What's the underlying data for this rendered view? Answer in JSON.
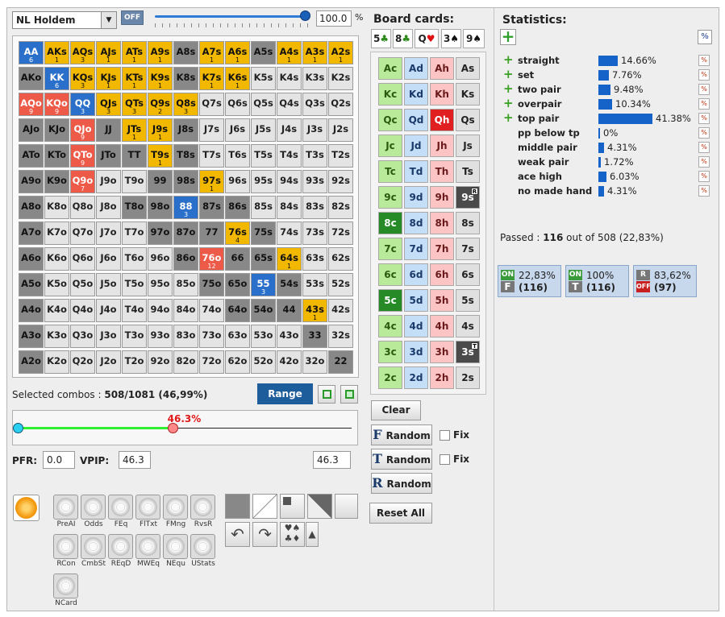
{
  "game_select": {
    "value": "NL Holdem"
  },
  "off_label": "OFF",
  "slider_value": "100.0",
  "slider_unit": "%",
  "board_title": "Board cards:",
  "board": [
    {
      "rank": "5",
      "suit": "♣",
      "color": "#2a8a1a"
    },
    {
      "rank": "8",
      "suit": "♣",
      "color": "#2a8a1a"
    },
    {
      "rank": "Q",
      "suit": "♥",
      "color": "#e01010"
    },
    {
      "rank": "3",
      "suit": "♠",
      "color": "#111111"
    },
    {
      "rank": "9",
      "suit": "♠",
      "color": "#111111"
    }
  ],
  "grid": [
    [
      [
        "AA",
        "6",
        "blue"
      ],
      [
        "AKs",
        "1",
        "yellow"
      ],
      [
        "AQs",
        "3",
        "yellow"
      ],
      [
        "AJs",
        "1",
        "yellow"
      ],
      [
        "ATs",
        "1",
        "yellow"
      ],
      [
        "A9s",
        "1",
        "yellow"
      ],
      [
        "A8s",
        "",
        "gray"
      ],
      [
        "A7s",
        "1",
        "yellow"
      ],
      [
        "A6s",
        "1",
        "yellow"
      ],
      [
        "A5s",
        "",
        "gray"
      ],
      [
        "A4s",
        "1",
        "yellow"
      ],
      [
        "A3s",
        "1",
        "yellow"
      ],
      [
        "A2s",
        "1",
        "yellow"
      ]
    ],
    [
      [
        "AKo",
        "",
        "gray"
      ],
      [
        "KK",
        "6",
        "blue"
      ],
      [
        "KQs",
        "3",
        "yellow"
      ],
      [
        "KJs",
        "1",
        "yellow"
      ],
      [
        "KTs",
        "1",
        "yellow"
      ],
      [
        "K9s",
        "1",
        "yellow"
      ],
      [
        "K8s",
        "",
        "gray"
      ],
      [
        "K7s",
        "1",
        "yellow"
      ],
      [
        "K6s",
        "1",
        "yellow"
      ],
      [
        "K5s",
        "",
        "empty"
      ],
      [
        "K4s",
        "",
        "empty"
      ],
      [
        "K3s",
        "",
        "empty"
      ],
      [
        "K2s",
        "",
        "empty"
      ]
    ],
    [
      [
        "AQo",
        "9",
        "red"
      ],
      [
        "KQo",
        "9",
        "red"
      ],
      [
        "QQ",
        "3",
        "blue"
      ],
      [
        "QJs",
        "3",
        "yellow"
      ],
      [
        "QTs",
        "3",
        "yellow"
      ],
      [
        "Q9s",
        "2",
        "yellow"
      ],
      [
        "Q8s",
        "3",
        "yellow"
      ],
      [
        "Q7s",
        "",
        "empty"
      ],
      [
        "Q6s",
        "",
        "empty"
      ],
      [
        "Q5s",
        "",
        "empty"
      ],
      [
        "Q4s",
        "",
        "empty"
      ],
      [
        "Q3s",
        "",
        "empty"
      ],
      [
        "Q2s",
        "",
        "empty"
      ]
    ],
    [
      [
        "AJo",
        "",
        "gray"
      ],
      [
        "KJo",
        "",
        "gray"
      ],
      [
        "QJo",
        "9",
        "red"
      ],
      [
        "JJ",
        "",
        "gray"
      ],
      [
        "JTs",
        "1",
        "yellow"
      ],
      [
        "J9s",
        "1",
        "yellow"
      ],
      [
        "J8s",
        "",
        "gray"
      ],
      [
        "J7s",
        "",
        "empty"
      ],
      [
        "J6s",
        "",
        "empty"
      ],
      [
        "J5s",
        "",
        "empty"
      ],
      [
        "J4s",
        "",
        "empty"
      ],
      [
        "J3s",
        "",
        "empty"
      ],
      [
        "J2s",
        "",
        "empty"
      ]
    ],
    [
      [
        "ATo",
        "",
        "gray"
      ],
      [
        "KTo",
        "",
        "gray"
      ],
      [
        "QTo",
        "9",
        "red"
      ],
      [
        "JTo",
        "",
        "gray"
      ],
      [
        "TT",
        "",
        "gray"
      ],
      [
        "T9s",
        "1",
        "yellow"
      ],
      [
        "T8s",
        "",
        "gray"
      ],
      [
        "T7s",
        "",
        "empty"
      ],
      [
        "T6s",
        "",
        "empty"
      ],
      [
        "T5s",
        "",
        "empty"
      ],
      [
        "T4s",
        "",
        "empty"
      ],
      [
        "T3s",
        "",
        "empty"
      ],
      [
        "T2s",
        "",
        "empty"
      ]
    ],
    [
      [
        "A9o",
        "",
        "gray"
      ],
      [
        "K9o",
        "",
        "gray"
      ],
      [
        "Q9o",
        "7",
        "red"
      ],
      [
        "J9o",
        "",
        "empty"
      ],
      [
        "T9o",
        "",
        "empty"
      ],
      [
        "99",
        "",
        "gray"
      ],
      [
        "98s",
        "",
        "gray"
      ],
      [
        "97s",
        "1",
        "yellow"
      ],
      [
        "96s",
        "",
        "empty"
      ],
      [
        "95s",
        "",
        "empty"
      ],
      [
        "94s",
        "",
        "empty"
      ],
      [
        "93s",
        "",
        "empty"
      ],
      [
        "92s",
        "",
        "empty"
      ]
    ],
    [
      [
        "A8o",
        "",
        "gray"
      ],
      [
        "K8o",
        "",
        "empty"
      ],
      [
        "Q8o",
        "",
        "empty"
      ],
      [
        "J8o",
        "",
        "empty"
      ],
      [
        "T8o",
        "",
        "gray"
      ],
      [
        "98o",
        "",
        "gray"
      ],
      [
        "88",
        "3",
        "blue"
      ],
      [
        "87s",
        "",
        "gray"
      ],
      [
        "86s",
        "",
        "gray"
      ],
      [
        "85s",
        "",
        "empty"
      ],
      [
        "84s",
        "",
        "empty"
      ],
      [
        "83s",
        "",
        "empty"
      ],
      [
        "82s",
        "",
        "empty"
      ]
    ],
    [
      [
        "A7o",
        "",
        "gray"
      ],
      [
        "K7o",
        "",
        "empty"
      ],
      [
        "Q7o",
        "",
        "empty"
      ],
      [
        "J7o",
        "",
        "empty"
      ],
      [
        "T7o",
        "",
        "empty"
      ],
      [
        "97o",
        "",
        "gray"
      ],
      [
        "87o",
        "",
        "gray"
      ],
      [
        "77",
        "",
        "gray"
      ],
      [
        "76s",
        "4",
        "yellow"
      ],
      [
        "75s",
        "",
        "gray"
      ],
      [
        "74s",
        "",
        "empty"
      ],
      [
        "73s",
        "",
        "empty"
      ],
      [
        "72s",
        "",
        "empty"
      ]
    ],
    [
      [
        "A6o",
        "",
        "gray"
      ],
      [
        "K6o",
        "",
        "empty"
      ],
      [
        "Q6o",
        "",
        "empty"
      ],
      [
        "J6o",
        "",
        "empty"
      ],
      [
        "T6o",
        "",
        "empty"
      ],
      [
        "96o",
        "",
        "empty"
      ],
      [
        "86o",
        "",
        "gray"
      ],
      [
        "76o",
        "12",
        "red"
      ],
      [
        "66",
        "",
        "gray"
      ],
      [
        "65s",
        "",
        "gray"
      ],
      [
        "64s",
        "1",
        "yellow"
      ],
      [
        "63s",
        "",
        "empty"
      ],
      [
        "62s",
        "",
        "empty"
      ]
    ],
    [
      [
        "A5o",
        "",
        "gray"
      ],
      [
        "K5o",
        "",
        "empty"
      ],
      [
        "Q5o",
        "",
        "empty"
      ],
      [
        "J5o",
        "",
        "empty"
      ],
      [
        "T5o",
        "",
        "empty"
      ],
      [
        "95o",
        "",
        "empty"
      ],
      [
        "85o",
        "",
        "empty"
      ],
      [
        "75o",
        "",
        "gray"
      ],
      [
        "65o",
        "",
        "gray"
      ],
      [
        "55",
        "3",
        "blue"
      ],
      [
        "54s",
        "",
        "gray"
      ],
      [
        "53s",
        "",
        "empty"
      ],
      [
        "52s",
        "",
        "empty"
      ]
    ],
    [
      [
        "A4o",
        "",
        "gray"
      ],
      [
        "K4o",
        "",
        "empty"
      ],
      [
        "Q4o",
        "",
        "empty"
      ],
      [
        "J4o",
        "",
        "empty"
      ],
      [
        "T4o",
        "",
        "empty"
      ],
      [
        "94o",
        "",
        "empty"
      ],
      [
        "84o",
        "",
        "empty"
      ],
      [
        "74o",
        "",
        "empty"
      ],
      [
        "64o",
        "",
        "gray"
      ],
      [
        "54o",
        "",
        "gray"
      ],
      [
        "44",
        "",
        "gray"
      ],
      [
        "43s",
        "1",
        "yellow"
      ],
      [
        "42s",
        "",
        "empty"
      ]
    ],
    [
      [
        "A3o",
        "",
        "gray"
      ],
      [
        "K3o",
        "",
        "empty"
      ],
      [
        "Q3o",
        "",
        "empty"
      ],
      [
        "J3o",
        "",
        "empty"
      ],
      [
        "T3o",
        "",
        "empty"
      ],
      [
        "93o",
        "",
        "empty"
      ],
      [
        "83o",
        "",
        "empty"
      ],
      [
        "73o",
        "",
        "empty"
      ],
      [
        "63o",
        "",
        "empty"
      ],
      [
        "53o",
        "",
        "empty"
      ],
      [
        "43o",
        "",
        "empty"
      ],
      [
        "33",
        "",
        "gray"
      ],
      [
        "32s",
        "",
        "empty"
      ]
    ],
    [
      [
        "A2o",
        "",
        "gray"
      ],
      [
        "K2o",
        "",
        "empty"
      ],
      [
        "Q2o",
        "",
        "empty"
      ],
      [
        "J2o",
        "",
        "empty"
      ],
      [
        "T2o",
        "",
        "empty"
      ],
      [
        "92o",
        "",
        "empty"
      ],
      [
        "82o",
        "",
        "empty"
      ],
      [
        "72o",
        "",
        "empty"
      ],
      [
        "62o",
        "",
        "empty"
      ],
      [
        "52o",
        "",
        "empty"
      ],
      [
        "42o",
        "",
        "empty"
      ],
      [
        "32o",
        "",
        "empty"
      ],
      [
        "22",
        "",
        "gray"
      ]
    ]
  ],
  "board_grid": [
    [
      [
        "Ac",
        "green",
        ""
      ],
      [
        "Ad",
        "blue",
        ""
      ],
      [
        "Ah",
        "pink",
        ""
      ],
      [
        "As",
        "gray",
        ""
      ]
    ],
    [
      [
        "Kc",
        "green",
        ""
      ],
      [
        "Kd",
        "blue",
        ""
      ],
      [
        "Kh",
        "pink",
        ""
      ],
      [
        "Ks",
        "gray",
        ""
      ]
    ],
    [
      [
        "Qc",
        "green",
        ""
      ],
      [
        "Qd",
        "blue",
        ""
      ],
      [
        "Qh",
        "red",
        ""
      ],
      [
        "Qs",
        "gray",
        ""
      ]
    ],
    [
      [
        "Jc",
        "green",
        ""
      ],
      [
        "Jd",
        "blue",
        ""
      ],
      [
        "Jh",
        "pink",
        ""
      ],
      [
        "Js",
        "gray",
        ""
      ]
    ],
    [
      [
        "Tc",
        "green",
        ""
      ],
      [
        "Td",
        "blue",
        ""
      ],
      [
        "Th",
        "pink",
        ""
      ],
      [
        "Ts",
        "gray",
        ""
      ]
    ],
    [
      [
        "9c",
        "green",
        ""
      ],
      [
        "9d",
        "blue",
        ""
      ],
      [
        "9h",
        "pink",
        ""
      ],
      [
        "9s",
        "dark",
        "R"
      ]
    ],
    [
      [
        "8c",
        "dgreen",
        ""
      ],
      [
        "8d",
        "blue",
        ""
      ],
      [
        "8h",
        "pink",
        ""
      ],
      [
        "8s",
        "gray",
        ""
      ]
    ],
    [
      [
        "7c",
        "green",
        ""
      ],
      [
        "7d",
        "blue",
        ""
      ],
      [
        "7h",
        "pink",
        ""
      ],
      [
        "7s",
        "gray",
        ""
      ]
    ],
    [
      [
        "6c",
        "green",
        ""
      ],
      [
        "6d",
        "blue",
        ""
      ],
      [
        "6h",
        "pink",
        ""
      ],
      [
        "6s",
        "gray",
        ""
      ]
    ],
    [
      [
        "5c",
        "dgreen",
        ""
      ],
      [
        "5d",
        "blue",
        ""
      ],
      [
        "5h",
        "pink",
        ""
      ],
      [
        "5s",
        "gray",
        ""
      ]
    ],
    [
      [
        "4c",
        "green",
        ""
      ],
      [
        "4d",
        "blue",
        ""
      ],
      [
        "4h",
        "pink",
        ""
      ],
      [
        "4s",
        "gray",
        ""
      ]
    ],
    [
      [
        "3c",
        "green",
        ""
      ],
      [
        "3d",
        "blue",
        ""
      ],
      [
        "3h",
        "pink",
        ""
      ],
      [
        "3s",
        "dark",
        "T"
      ]
    ],
    [
      [
        "2c",
        "green",
        ""
      ],
      [
        "2d",
        "blue",
        ""
      ],
      [
        "2h",
        "pink",
        ""
      ],
      [
        "2s",
        "gray",
        ""
      ]
    ]
  ],
  "selected_combos_label": "Selected combos :",
  "selected_combos_value": "508/1081 (46,99%)",
  "range_button": "Range",
  "range_slider_value": "46.3%",
  "range_slider_fraction": 0.463,
  "pfr_label": "PFR:",
  "pfr_value": "0.0",
  "vpip_label": "VPIP:",
  "vpip_value": "46.3",
  "right_value": "46.3",
  "clear_button": "Clear",
  "random_buttons": [
    {
      "letter": "F",
      "label": "Random",
      "fix": "Fix"
    },
    {
      "letter": "T",
      "label": "Random",
      "fix": "Fix"
    },
    {
      "letter": "R",
      "label": "Random",
      "fix": ""
    }
  ],
  "reset_all_button": "Reset All",
  "tools": [
    "PreAI",
    "Odds",
    "FEq",
    "FlTxt",
    "FMng",
    "RvsR",
    "RCon",
    "CmbSt",
    "REqD",
    "MWEq",
    "NEqu",
    "UStats",
    "NCard"
  ],
  "stats_title": "Statistics:",
  "pct_label": "%",
  "stats": [
    {
      "label": "straight",
      "value": "14.66%",
      "frac": 0.1466,
      "plus": true
    },
    {
      "label": "set",
      "value": "7.76%",
      "frac": 0.0776,
      "plus": true
    },
    {
      "label": "two pair",
      "value": "9.48%",
      "frac": 0.0948,
      "plus": true
    },
    {
      "label": "overpair",
      "value": "10.34%",
      "frac": 0.1034,
      "plus": true
    },
    {
      "label": "top pair",
      "value": "41.38%",
      "frac": 0.4138,
      "plus": true
    },
    {
      "label": "pp below tp",
      "value": "0%",
      "frac": 0,
      "plus": false
    },
    {
      "label": "middle pair",
      "value": "4.31%",
      "frac": 0.0431,
      "plus": false
    },
    {
      "label": "weak pair",
      "value": "1.72%",
      "frac": 0.0172,
      "plus": false
    },
    {
      "label": "ace high",
      "value": "6.03%",
      "frac": 0.0603,
      "plus": false
    },
    {
      "label": "no made hand",
      "value": "4.31%",
      "frac": 0.0431,
      "plus": false
    }
  ],
  "passed_prefix": "Passed :",
  "passed_count": "116",
  "passed_suffix": "out of 508 (22,83%)",
  "filter_boxes": [
    {
      "top_tag": "ON",
      "bottom_tag": "F",
      "pct": "22,83%",
      "count": "(116)"
    },
    {
      "top_tag": "ON",
      "bottom_tag": "T",
      "pct": "100%",
      "count": "(116)"
    },
    {
      "top_tag": "R",
      "bottom_tag": "OFF",
      "pct": "83,62%",
      "count": "(97)"
    }
  ]
}
